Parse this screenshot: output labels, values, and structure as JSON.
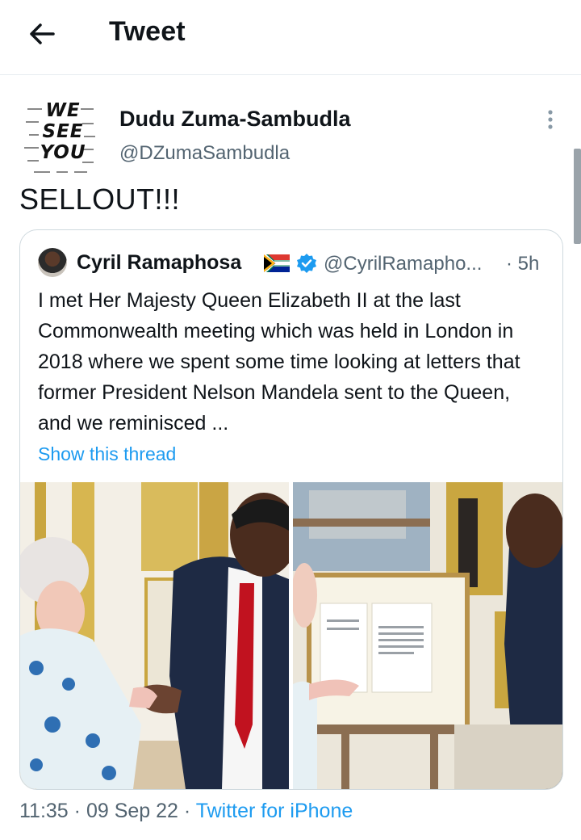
{
  "header": {
    "title": "Tweet",
    "back_icon": "arrow-left-icon"
  },
  "tweet": {
    "avatar_text": "WE SEE YOU",
    "display_name": "Dudu Zuma-Sambudla",
    "handle": "@DZumaSambudla",
    "text": "SELLOUT!!!",
    "more_icon": "vertical-ellipsis-icon",
    "time": "11:35",
    "date": "09 Sep 22",
    "source": "Twitter for iPhone",
    "separator": "·"
  },
  "quote": {
    "display_name": "Cyril Ramaphosa",
    "flag_icon": "south-africa-flag-icon",
    "verified_icon": "verified-badge-icon",
    "handle": "@CyrilRamapho...",
    "time": "· 5h",
    "text": "I met Her Majesty Queen Elizabeth II at the last Commonwealth meeting which was held in London in 2018 where we spent some time looking  at letters that former President Nelson Mandela sent to the Queen, and we reminisced ...",
    "show_thread": "Show this thread",
    "media": [
      "handshake-photo",
      "letters-photo"
    ]
  },
  "colors": {
    "link": "#1d9bf0",
    "secondary_text": "#536471",
    "border": "#cfd9de"
  }
}
